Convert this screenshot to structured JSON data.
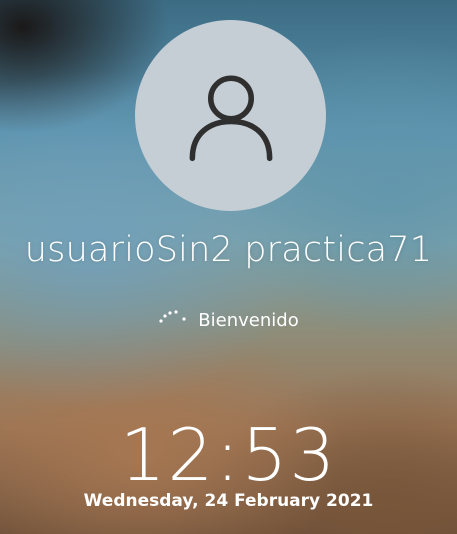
{
  "user": {
    "name": "usuarioSin2 practica71",
    "avatar_icon": "user-icon"
  },
  "status": {
    "text": "Bienvenido",
    "icon": "loading-spinner-icon"
  },
  "clock": {
    "time": "12:53",
    "date": "Wednesday, 24 February 2021"
  },
  "colors": {
    "avatar_bg": "#c4ced4",
    "avatar_glyph": "#2f2f2f",
    "text": "#ffffff"
  }
}
